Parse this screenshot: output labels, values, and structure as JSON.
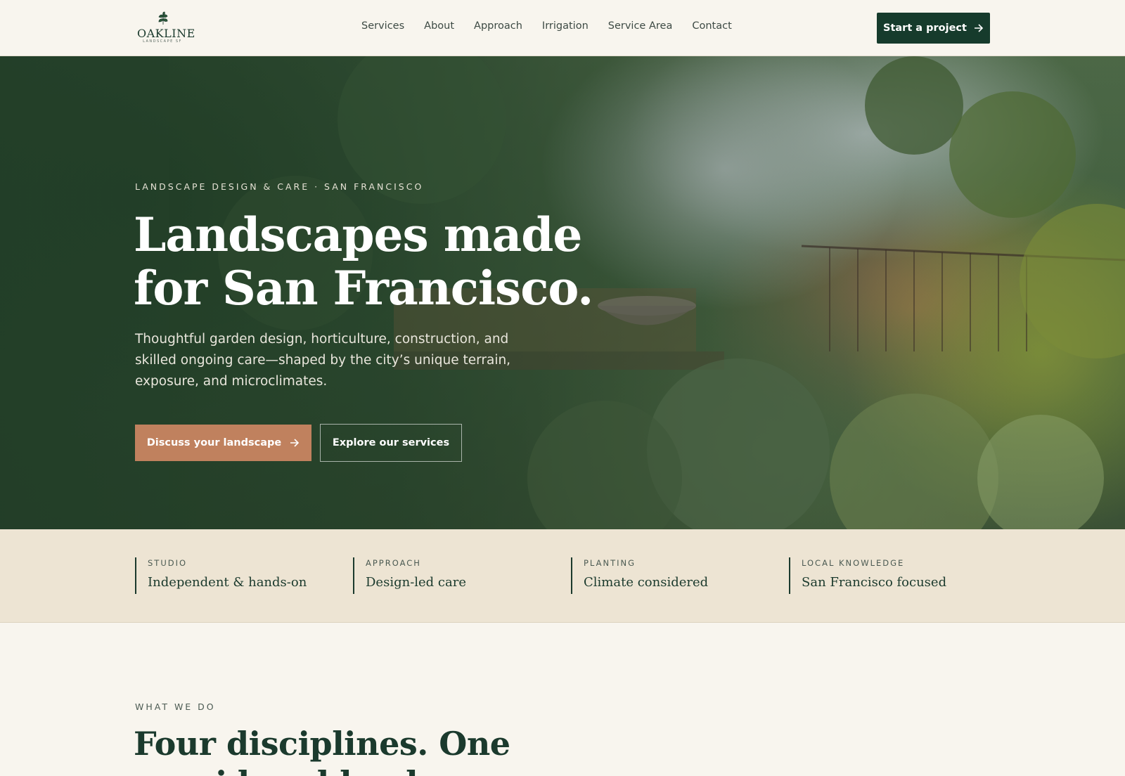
{
  "brand": {
    "name": "OAKLINE",
    "sub": "LANDSCAPE SF"
  },
  "nav": {
    "items": [
      {
        "label": "Services"
      },
      {
        "label": "About"
      },
      {
        "label": "Approach"
      },
      {
        "label": "Irrigation"
      },
      {
        "label": "Service Area"
      },
      {
        "label": "Contact"
      }
    ],
    "cta_label": "Start a project"
  },
  "hero": {
    "eyebrow": "LANDSCAPE DESIGN & CARE · SAN FRANCISCO",
    "title": "Landscapes made for San Francisco.",
    "description": "Thoughtful garden design, horticulture, construction, and skilled ongoing care—shaped by the city’s unique terrain, exposure, and microclimates.",
    "primary_button": "Discuss your landscape",
    "secondary_button": "Explore our services"
  },
  "features": [
    {
      "label": "STUDIO",
      "value": "Independent & hands-on"
    },
    {
      "label": "APPROACH",
      "value": "Design-led care"
    },
    {
      "label": "PLANTING",
      "value": "Climate considered"
    },
    {
      "label": "LOCAL KNOWLEDGE",
      "value": "San Francisco focused"
    }
  ],
  "section": {
    "eyebrow": "WHAT WE DO",
    "title": "Four disciplines. One considered landscape."
  },
  "colors": {
    "primary": "#163b2c",
    "accent": "#c0815e",
    "background": "#f8f5ee",
    "strip": "#ede4d3"
  },
  "icons": {
    "logo": "oak-leaf-icon",
    "cta_arrow": "arrow-right-icon"
  }
}
